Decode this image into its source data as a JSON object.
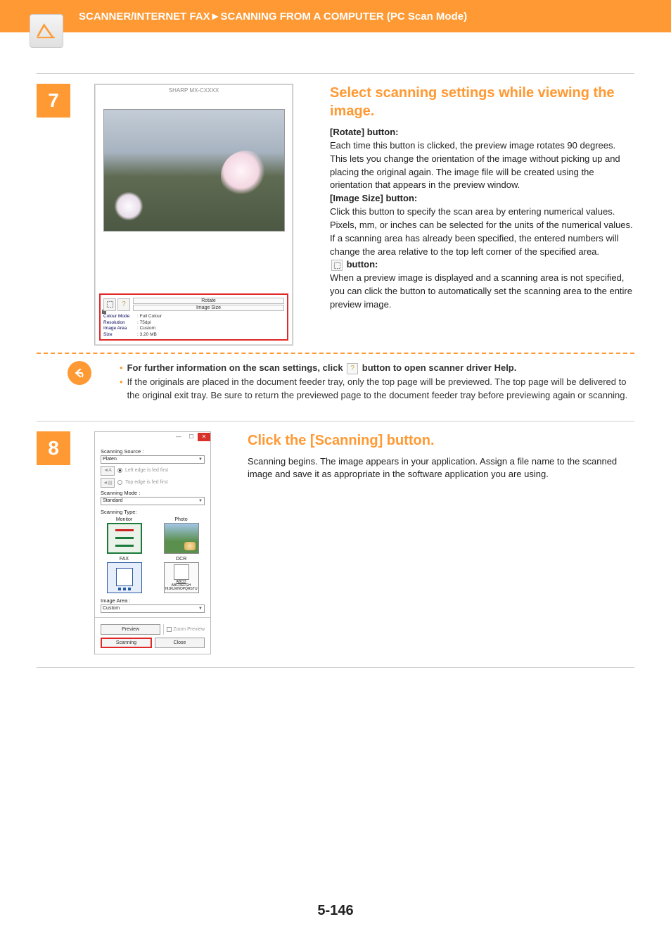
{
  "header": {
    "breadcrumb": "SCANNER/INTERNET FAX►SCANNING FROM A COMPUTER (PC Scan Mode)"
  },
  "step7": {
    "number": "7",
    "heading": "Select scanning settings while viewing the image.",
    "rotate_label": "[Rotate] button:",
    "rotate_text": "Each time this button is clicked, the preview image rotates 90 degrees. This lets you change the orientation of the image without picking up and placing the original again. The image file will be created using the orientation that appears in the preview window.",
    "imagesize_label": "[Image Size] button:",
    "imagesize_text": "Click this button to specify the scan area by entering numerical values. Pixels, mm, or inches can be selected for the units of the numerical values. If a scanning area has already been specified, the entered numbers will change the area relative to the top left corner of the specified area.",
    "cropbtn_label": " button:",
    "cropbtn_text": "When a preview image is displayed and a scanning area is not specified, you can click the button to automatically set the scanning area to the entire preview image.",
    "screenshot": {
      "title": "SHARP MX-CXXXX",
      "btn_rotate": "Rotate",
      "btn_imagesize": "Image Size",
      "rows": {
        "colormode_lbl": "Colour Mode",
        "colormode_val": ": Full Colour",
        "resolution_lbl": "Resolution",
        "resolution_val": ": 75dpi",
        "imagearea_lbl": "Image Area",
        "imagearea_val": ": Custom",
        "size_lbl": "Size",
        "size_val": ": 3.20 MB"
      }
    }
  },
  "tips": {
    "line1a": "For further information on the scan settings, click ",
    "line1b": " button to open scanner driver Help.",
    "line2": "If the originals are placed in the document feeder tray, only the top page will be previewed. The top page will be delivered to the original exit tray. Be sure to return the previewed page to the document feeder tray before previewing again or scanning."
  },
  "step8": {
    "number": "8",
    "heading": "Click the [Scanning] button.",
    "text": "Scanning begins. The image appears in your application. Assign a file name to the scanned image and save it as appropriate in the software application you are using.",
    "screenshot": {
      "scanning_source_lbl": "Scanning Source :",
      "source_value": "Platen",
      "orient_left": "Left edge is fed first",
      "orient_top": "Top edge is fed first",
      "scanning_mode_lbl": "Scanning Mode :",
      "mode_value": "Standard",
      "scanning_type_lbl": "Scanning Type:",
      "type_monitor": "Monitor",
      "type_photo": "Photo",
      "type_fax": "FAX",
      "type_ocr": "OCR",
      "ocr_text1": "ABCD",
      "ocr_text2": "ABCDEFGH",
      "ocr_text3": "HIJKLMNOPQRSTU",
      "image_area_lbl": "Image Area :",
      "image_area_value": "Custom",
      "btn_preview": "Preview",
      "zoom_preview": "Zoom Preview",
      "btn_scanning": "Scanning",
      "btn_close": "Close"
    }
  },
  "page_number": "5-146"
}
